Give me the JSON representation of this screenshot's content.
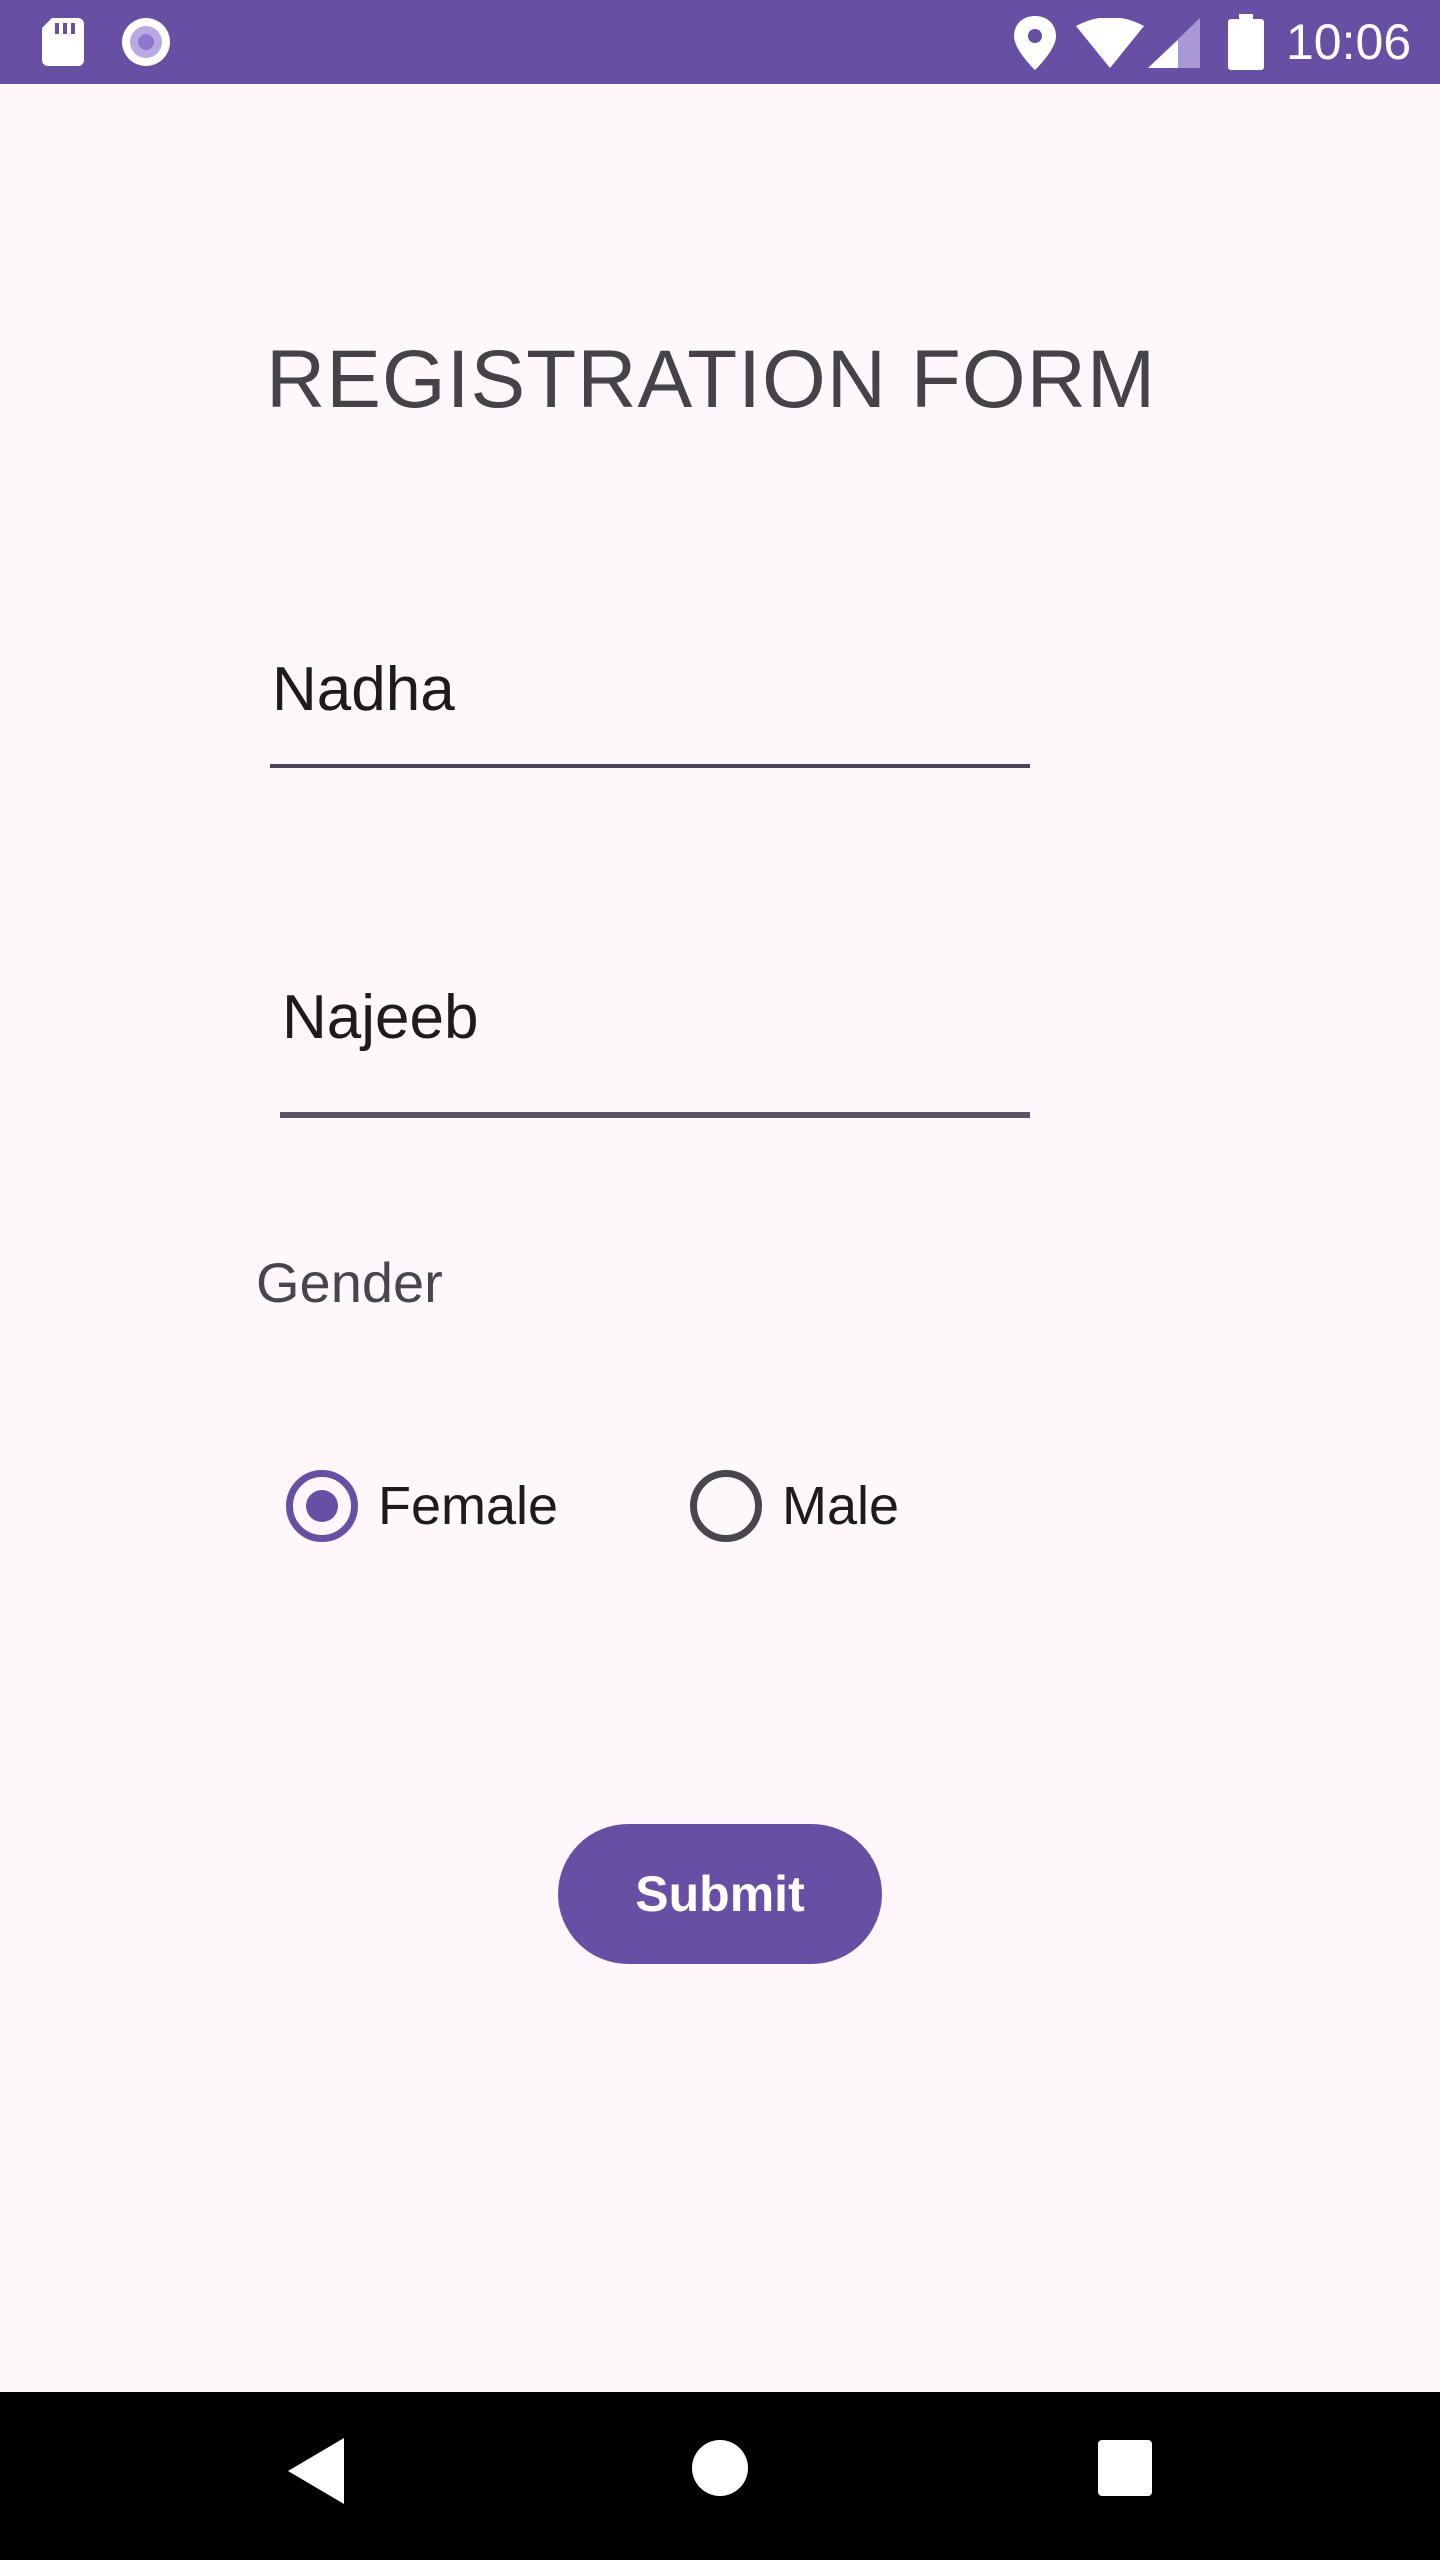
{
  "status_bar": {
    "time": "10:06",
    "icons": [
      "sd-card-icon",
      "sync-icon",
      "location-icon",
      "wifi-icon",
      "signal-icon",
      "battery-icon"
    ]
  },
  "form": {
    "title": "REGISTRATION FORM",
    "first_name_value": "Nadha",
    "last_name_value": "Najeeb",
    "gender_label": "Gender",
    "gender_options": [
      {
        "label": "Female",
        "checked": true
      },
      {
        "label": "Male",
        "checked": false
      }
    ],
    "submit_label": "Submit"
  },
  "nav_bar": {
    "icons": [
      "back-icon",
      "home-icon",
      "recents-icon"
    ]
  },
  "colors": {
    "primary": "#6750a4",
    "background": "#fef7fb",
    "text": "#1d1b20",
    "secondary_text": "#49454f",
    "nav_background": "#000000"
  }
}
